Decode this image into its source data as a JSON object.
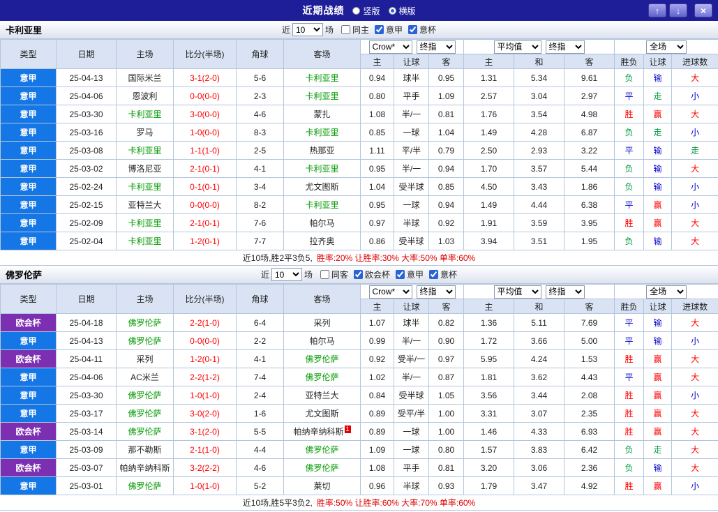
{
  "topbar": {
    "title": "近期战绩",
    "radio_vertical": "竖版",
    "radio_horizontal": "横版",
    "up_icon": "↑",
    "down_icon": "↓",
    "close_icon": "×"
  },
  "table_header": {
    "near_label": "近",
    "matches_count": "10",
    "matches_suffix": "场",
    "col_type": "类型",
    "col_date": "日期",
    "col_home": "主场",
    "col_score": "比分(半场)",
    "col_corner": "角球",
    "col_away": "客场",
    "bookmaker_select": "Crow*",
    "bookmaker_stage_select": "终指",
    "average_select": "平均值",
    "average_stage_select": "终指",
    "scope_select": "全场",
    "sub_home": "主",
    "sub_handicap": "让球",
    "sub_away": "客",
    "sub_avg_home": "主",
    "sub_avg_draw": "和",
    "sub_avg_away": "客",
    "sub_result": "胜负",
    "sub_handicap_result": "让球",
    "sub_goals": "进球数"
  },
  "colors": {
    "topbar_bg": "#1e1e99",
    "header_bg": "#d9e3f3",
    "grid_line": "#b3c6dd",
    "league_serie_a": "#1577e6",
    "league_conference": "#7c2fb0",
    "focal_team": "#009900",
    "score": "#ff0000",
    "result_red": "#ff0000",
    "result_blue": "#0000cc",
    "result_green": "#009944"
  },
  "result_color_map": {
    "胜": "red",
    "赢": "red",
    "大": "red",
    "平": "blue",
    "输": "blue",
    "小": "blue",
    "负": "green",
    "走": "green"
  },
  "sections": [
    {
      "team": "卡利亚里",
      "checkboxes": [
        {
          "label": "同主",
          "checked": false
        },
        {
          "label": "意甲",
          "checked": true
        },
        {
          "label": "意杯",
          "checked": true
        }
      ],
      "rows": [
        {
          "league": "意甲",
          "league_style": "blue",
          "date": "25-04-13",
          "home": "国际米兰",
          "home_focal": false,
          "score": "3-1(2-0)",
          "corners": "5-6",
          "away": "卡利亚里",
          "away_focal": true,
          "odds_home": "0.94",
          "odds_line": "球半",
          "odds_away": "0.95",
          "avg_home": "1.31",
          "avg_draw": "5.34",
          "avg_away": "9.61",
          "res_match": "负",
          "res_handicap": "输",
          "res_goals": "大"
        },
        {
          "league": "意甲",
          "league_style": "blue",
          "date": "25-04-06",
          "home": "恩波利",
          "home_focal": false,
          "score": "0-0(0-0)",
          "corners": "2-3",
          "away": "卡利亚里",
          "away_focal": true,
          "odds_home": "0.80",
          "odds_line": "平手",
          "odds_away": "1.09",
          "avg_home": "2.57",
          "avg_draw": "3.04",
          "avg_away": "2.97",
          "res_match": "平",
          "res_handicap": "走",
          "res_goals": "小"
        },
        {
          "league": "意甲",
          "league_style": "blue",
          "date": "25-03-30",
          "home": "卡利亚里",
          "home_focal": true,
          "score": "3-0(0-0)",
          "corners": "4-6",
          "away": "蒙扎",
          "away_focal": false,
          "odds_home": "1.08",
          "odds_line": "半/一",
          "odds_away": "0.81",
          "avg_home": "1.76",
          "avg_draw": "3.54",
          "avg_away": "4.98",
          "res_match": "胜",
          "res_handicap": "赢",
          "res_goals": "大"
        },
        {
          "league": "意甲",
          "league_style": "blue",
          "date": "25-03-16",
          "home": "罗马",
          "home_focal": false,
          "score": "1-0(0-0)",
          "corners": "8-3",
          "away": "卡利亚里",
          "away_focal": true,
          "odds_home": "0.85",
          "odds_line": "一球",
          "odds_away": "1.04",
          "avg_home": "1.49",
          "avg_draw": "4.28",
          "avg_away": "6.87",
          "res_match": "负",
          "res_handicap": "走",
          "res_goals": "小"
        },
        {
          "league": "意甲",
          "league_style": "blue",
          "date": "25-03-08",
          "home": "卡利亚里",
          "home_focal": true,
          "score": "1-1(1-0)",
          "corners": "2-5",
          "away": "热那亚",
          "away_focal": false,
          "odds_home": "1.11",
          "odds_line": "平/半",
          "odds_away": "0.79",
          "avg_home": "2.50",
          "avg_draw": "2.93",
          "avg_away": "3.22",
          "res_match": "平",
          "res_handicap": "输",
          "res_goals": "走"
        },
        {
          "league": "意甲",
          "league_style": "blue",
          "date": "25-03-02",
          "home": "博洛尼亚",
          "home_focal": false,
          "score": "2-1(0-1)",
          "corners": "4-1",
          "away": "卡利亚里",
          "away_focal": true,
          "odds_home": "0.95",
          "odds_line": "半/一",
          "odds_away": "0.94",
          "avg_home": "1.70",
          "avg_draw": "3.57",
          "avg_away": "5.44",
          "res_match": "负",
          "res_handicap": "输",
          "res_goals": "大"
        },
        {
          "league": "意甲",
          "league_style": "blue",
          "date": "25-02-24",
          "home": "卡利亚里",
          "home_focal": true,
          "score": "0-1(0-1)",
          "corners": "3-4",
          "away": "尤文图斯",
          "away_focal": false,
          "odds_home": "1.04",
          "odds_line": "受半球",
          "odds_away": "0.85",
          "avg_home": "4.50",
          "avg_draw": "3.43",
          "avg_away": "1.86",
          "res_match": "负",
          "res_handicap": "输",
          "res_goals": "小"
        },
        {
          "league": "意甲",
          "league_style": "blue",
          "date": "25-02-15",
          "home": "亚特兰大",
          "home_focal": false,
          "score": "0-0(0-0)",
          "corners": "8-2",
          "away": "卡利亚里",
          "away_focal": true,
          "odds_home": "0.95",
          "odds_line": "一球",
          "odds_away": "0.94",
          "avg_home": "1.49",
          "avg_draw": "4.44",
          "avg_away": "6.38",
          "res_match": "平",
          "res_handicap": "赢",
          "res_goals": "小"
        },
        {
          "league": "意甲",
          "league_style": "blue",
          "date": "25-02-09",
          "home": "卡利亚里",
          "home_focal": true,
          "score": "2-1(0-1)",
          "corners": "7-6",
          "away": "帕尔马",
          "away_focal": false,
          "odds_home": "0.97",
          "odds_line": "半球",
          "odds_away": "0.92",
          "avg_home": "1.91",
          "avg_draw": "3.59",
          "avg_away": "3.95",
          "res_match": "胜",
          "res_handicap": "赢",
          "res_goals": "大"
        },
        {
          "league": "意甲",
          "league_style": "blue",
          "date": "25-02-04",
          "home": "卡利亚里",
          "home_focal": true,
          "score": "1-2(0-1)",
          "corners": "7-7",
          "away": "拉齐奥",
          "away_focal": false,
          "odds_home": "0.86",
          "odds_line": "受半球",
          "odds_away": "1.03",
          "avg_home": "3.94",
          "avg_draw": "3.51",
          "avg_away": "1.95",
          "res_match": "负",
          "res_handicap": "输",
          "res_goals": "大"
        }
      ],
      "summary_prefix": "近10场,胜2平3负5,",
      "summary_stats": "胜率:20% 让胜率:30% 大率:50% 单率:60%"
    },
    {
      "team": "佛罗伦萨",
      "checkboxes": [
        {
          "label": "同客",
          "checked": false
        },
        {
          "label": "欧会杯",
          "checked": true
        },
        {
          "label": "意甲",
          "checked": true
        },
        {
          "label": "意杯",
          "checked": true
        }
      ],
      "rows": [
        {
          "league": "欧会杯",
          "league_style": "purple",
          "date": "25-04-18",
          "home": "佛罗伦萨",
          "home_focal": true,
          "score": "2-2(1-0)",
          "corners": "6-4",
          "away": "采列",
          "away_focal": false,
          "odds_home": "1.07",
          "odds_line": "球半",
          "odds_away": "0.82",
          "avg_home": "1.36",
          "avg_draw": "5.11",
          "avg_away": "7.69",
          "res_match": "平",
          "res_handicap": "输",
          "res_goals": "大"
        },
        {
          "league": "意甲",
          "league_style": "blue",
          "date": "25-04-13",
          "home": "佛罗伦萨",
          "home_focal": true,
          "score": "0-0(0-0)",
          "corners": "2-2",
          "away": "帕尔马",
          "away_focal": false,
          "odds_home": "0.99",
          "odds_line": "半/一",
          "odds_away": "0.90",
          "avg_home": "1.72",
          "avg_draw": "3.66",
          "avg_away": "5.00",
          "res_match": "平",
          "res_handicap": "输",
          "res_goals": "小"
        },
        {
          "league": "欧会杯",
          "league_style": "purple",
          "date": "25-04-11",
          "home": "采列",
          "home_focal": false,
          "score": "1-2(0-1)",
          "corners": "4-1",
          "away": "佛罗伦萨",
          "away_focal": true,
          "odds_home": "0.92",
          "odds_line": "受半/一",
          "odds_away": "0.97",
          "avg_home": "5.95",
          "avg_draw": "4.24",
          "avg_away": "1.53",
          "res_match": "胜",
          "res_handicap": "赢",
          "res_goals": "大"
        },
        {
          "league": "意甲",
          "league_style": "blue",
          "date": "25-04-06",
          "home": "AC米兰",
          "home_focal": false,
          "score": "2-2(1-2)",
          "corners": "7-4",
          "away": "佛罗伦萨",
          "away_focal": true,
          "odds_home": "1.02",
          "odds_line": "半/一",
          "odds_away": "0.87",
          "avg_home": "1.81",
          "avg_draw": "3.62",
          "avg_away": "4.43",
          "res_match": "平",
          "res_handicap": "赢",
          "res_goals": "大"
        },
        {
          "league": "意甲",
          "league_style": "blue",
          "date": "25-03-30",
          "home": "佛罗伦萨",
          "home_focal": true,
          "score": "1-0(1-0)",
          "corners": "2-4",
          "away": "亚特兰大",
          "away_focal": false,
          "odds_home": "0.84",
          "odds_line": "受半球",
          "odds_away": "1.05",
          "avg_home": "3.56",
          "avg_draw": "3.44",
          "avg_away": "2.08",
          "res_match": "胜",
          "res_handicap": "赢",
          "res_goals": "小"
        },
        {
          "league": "意甲",
          "league_style": "blue",
          "date": "25-03-17",
          "home": "佛罗伦萨",
          "home_focal": true,
          "score": "3-0(2-0)",
          "corners": "1-6",
          "away": "尤文图斯",
          "away_focal": false,
          "odds_home": "0.89",
          "odds_line": "受平/半",
          "odds_away": "1.00",
          "avg_home": "3.31",
          "avg_draw": "3.07",
          "avg_away": "2.35",
          "res_match": "胜",
          "res_handicap": "赢",
          "res_goals": "大"
        },
        {
          "league": "欧会杯",
          "league_style": "purple",
          "date": "25-03-14",
          "home": "佛罗伦萨",
          "home_focal": true,
          "score": "3-1(2-0)",
          "corners": "5-5",
          "away": "帕纳辛纳科斯",
          "away_focal": false,
          "away_badge": "1",
          "odds_home": "0.89",
          "odds_line": "一球",
          "odds_away": "1.00",
          "avg_home": "1.46",
          "avg_draw": "4.33",
          "avg_away": "6.93",
          "res_match": "胜",
          "res_handicap": "赢",
          "res_goals": "大"
        },
        {
          "league": "意甲",
          "league_style": "blue",
          "date": "25-03-09",
          "home": "那不勒斯",
          "home_focal": false,
          "score": "2-1(1-0)",
          "corners": "4-4",
          "away": "佛罗伦萨",
          "away_focal": true,
          "odds_home": "1.09",
          "odds_line": "一球",
          "odds_away": "0.80",
          "avg_home": "1.57",
          "avg_draw": "3.83",
          "avg_away": "6.42",
          "res_match": "负",
          "res_handicap": "走",
          "res_goals": "大"
        },
        {
          "league": "欧会杯",
          "league_style": "purple",
          "date": "25-03-07",
          "home": "帕纳辛纳科斯",
          "home_focal": false,
          "score": "3-2(2-2)",
          "corners": "4-6",
          "away": "佛罗伦萨",
          "away_focal": true,
          "odds_home": "1.08",
          "odds_line": "平手",
          "odds_away": "0.81",
          "avg_home": "3.20",
          "avg_draw": "3.06",
          "avg_away": "2.36",
          "res_match": "负",
          "res_handicap": "输",
          "res_goals": "大"
        },
        {
          "league": "意甲",
          "league_style": "blue",
          "date": "25-03-01",
          "home": "佛罗伦萨",
          "home_focal": true,
          "score": "1-0(1-0)",
          "corners": "5-2",
          "away": "莱切",
          "away_focal": false,
          "odds_home": "0.96",
          "odds_line": "半球",
          "odds_away": "0.93",
          "avg_home": "1.79",
          "avg_draw": "3.47",
          "avg_away": "4.92",
          "res_match": "胜",
          "res_handicap": "赢",
          "res_goals": "小"
        }
      ],
      "summary_prefix": "近10场,胜5平3负2,",
      "summary_stats": "胜率:50% 让胜率:60% 大率:70% 单率:60%"
    }
  ]
}
